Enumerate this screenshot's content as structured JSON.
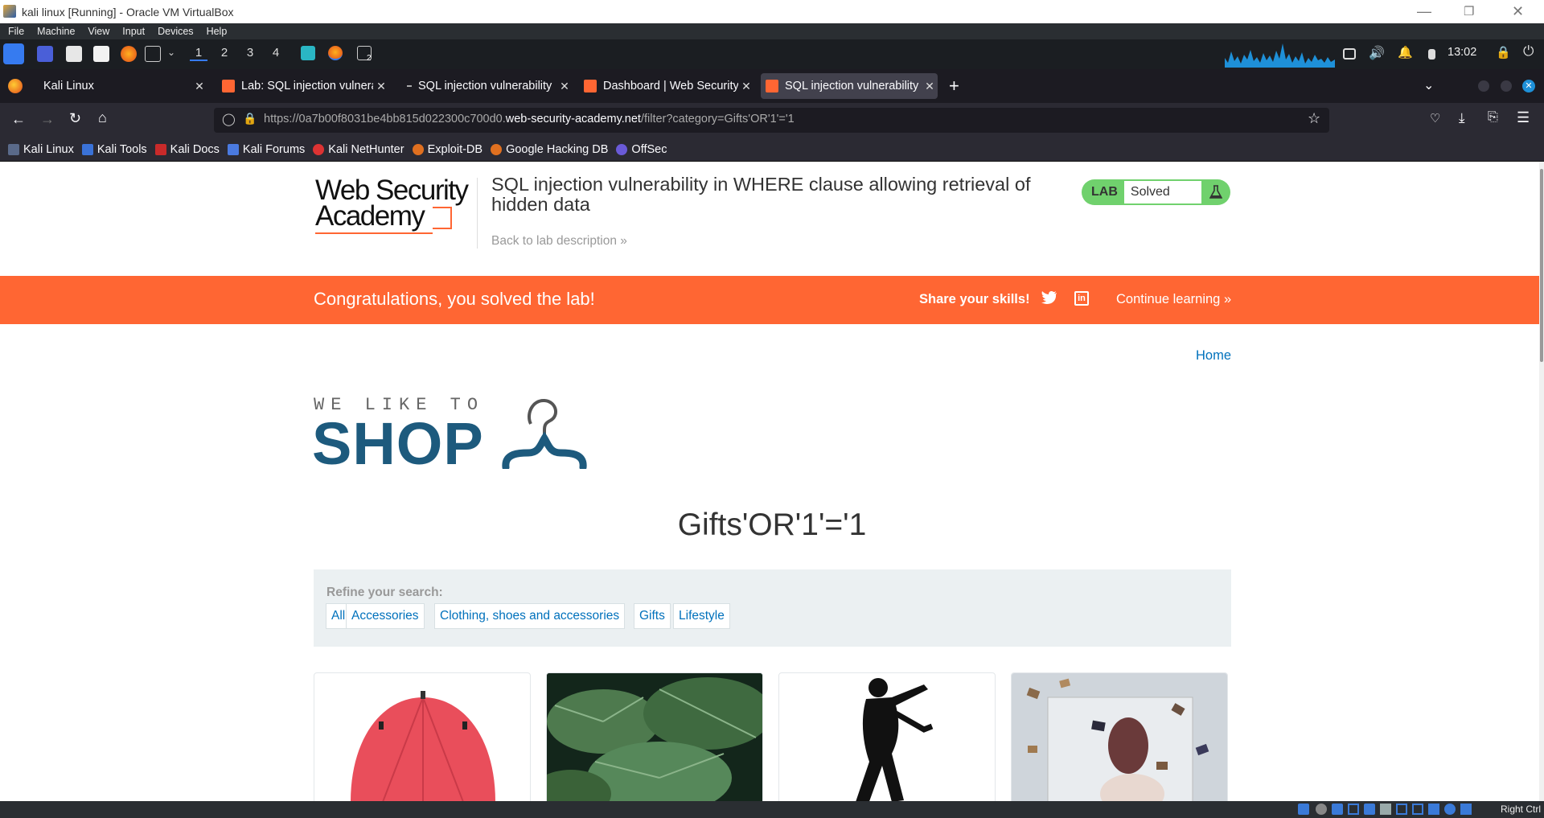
{
  "vbox": {
    "title": "kali linux [Running] - Oracle VM VirtualBox",
    "menu": [
      "File",
      "Machine",
      "View",
      "Input",
      "Devices",
      "Help"
    ],
    "status_right": "Right Ctrl"
  },
  "kali_panel": {
    "workspaces": [
      "1",
      "2",
      "3",
      "4"
    ],
    "clock": "13:02",
    "terminal_badge": "2"
  },
  "browser": {
    "tabs": [
      {
        "title": "Kali Linux",
        "active": false
      },
      {
        "title": "Lab: SQL injection vulnera",
        "active": false
      },
      {
        "title": "SQL injection vulnerability",
        "active": false
      },
      {
        "title": "Dashboard | Web Security",
        "active": false
      },
      {
        "title": "SQL injection vulnerability",
        "active": true
      }
    ],
    "url_prefix": "https://0a7b00f8031be4bb815d022300c700d0.",
    "url_domain": "web-security-academy.net",
    "url_path": "/filter?category=Gifts'OR'1'='1",
    "bookmarks": [
      "Kali Linux",
      "Kali Tools",
      "Kali Docs",
      "Kali Forums",
      "Kali NetHunter",
      "Exploit-DB",
      "Google Hacking DB",
      "OffSec"
    ]
  },
  "lab": {
    "logo_line1": "Web Security",
    "logo_line2": "Academy",
    "title": "SQL injection vulnerability in WHERE clause allowing retrieval of hidden data",
    "back_link": "Back to lab description",
    "badge_label": "LAB",
    "badge_status": "Solved",
    "banner_text": "Congratulations, you solved the lab!",
    "share_text": "Share your skills!",
    "continue_text": "Continue learning"
  },
  "shop": {
    "home_link": "Home",
    "logo_top": "WE LIKE TO",
    "logo_main": "SHOP",
    "category_heading": "Gifts'OR'1'='1",
    "refine_label": "Refine your search:",
    "filters": [
      "All",
      "Accessories",
      "Clothing, shoes and accessories",
      "Gifts",
      "Lifestyle"
    ]
  },
  "colors": {
    "banner": "#ff6633",
    "link": "#0071bc",
    "badge_green": "#70d16d",
    "shop_blue": "#1d5a7d"
  }
}
